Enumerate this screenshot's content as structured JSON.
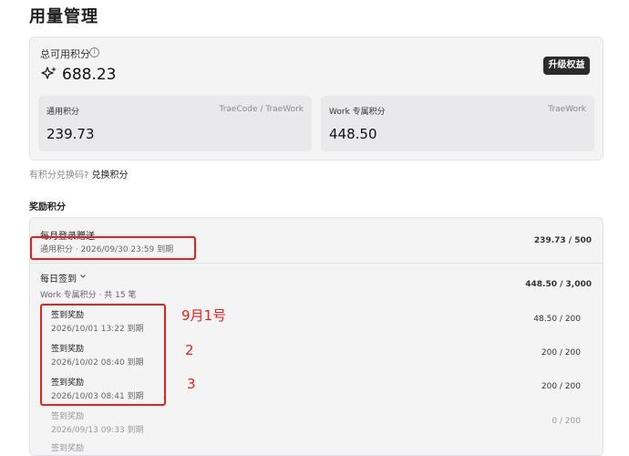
{
  "page": {
    "title": "用量管理"
  },
  "summary": {
    "total_label": "总可用积分",
    "total_value": "688.23",
    "upgrade_label": "升级权益",
    "info_icon": "info-icon",
    "value_icon": "sparkle-icon",
    "cards": [
      {
        "label": "通用积分",
        "source": "TraeCode / TraeWork",
        "value": "239.73"
      },
      {
        "label": "Work 专属积分",
        "source": "TraeWork",
        "value": "448.50"
      }
    ]
  },
  "redeem": {
    "prompt": "有积分兑换码?",
    "link": "兑换积分"
  },
  "rewards": {
    "title": "奖励积分",
    "monthly": {
      "title": "每月登录赠送",
      "subtitle": "通用积分 · 2026/09/30 23:59 到期",
      "amount": "239.73 / 500"
    },
    "daily": {
      "title": "每日签到",
      "subtitle": "Work 专属积分 · 共 15 笔",
      "amount": "448.50 / 3,000",
      "items": [
        {
          "title": "签到奖励",
          "expiry": "2026/10/01 13:22 到期",
          "amount": "48.50 / 200"
        },
        {
          "title": "签到奖励",
          "expiry": "2026/10/02 08:40 到期",
          "amount": "200 / 200"
        },
        {
          "title": "签到奖励",
          "expiry": "2026/10/03 08:41 到期",
          "amount": "200 / 200"
        },
        {
          "title": "签到奖励",
          "expiry": "2026/09/13 09:33 到期",
          "amount": "0 / 200"
        },
        {
          "title": "签到奖励"
        }
      ]
    }
  },
  "annotations": {
    "note1": "9月1号",
    "note2": "2",
    "note3": "3",
    "color": "#e8211c"
  }
}
